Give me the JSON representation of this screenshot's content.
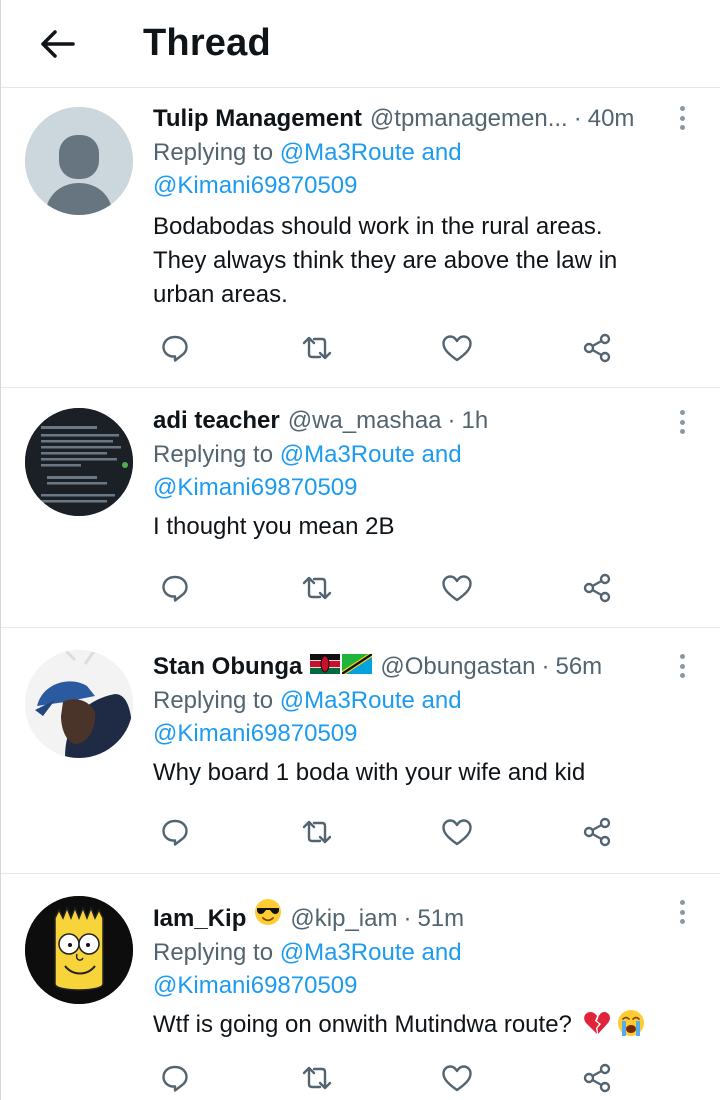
{
  "header": {
    "title": "Thread"
  },
  "tweets": [
    {
      "name": "Tulip Management",
      "handle": "@tpmanagemen...",
      "dot": "·",
      "time": "40m",
      "replying_prefix": "Replying to",
      "mention_1": "@Ma3Route",
      "and": "and",
      "mention_2": "@Kimani69870509",
      "text_lines": [
        "Bodabodas should work in the rural areas.",
        "They always think they are above the law in",
        "urban areas."
      ]
    },
    {
      "name": "adi teacher",
      "handle": "@wa_mashaa",
      "dot": "·",
      "time": "1h",
      "replying_prefix": "Replying to",
      "mention_1": "@Ma3Route",
      "and": "and",
      "mention_2": "@Kimani69870509",
      "text_lines": [
        "I thought you mean 2B"
      ]
    },
    {
      "name": "Stan Obunga",
      "handle": "@Obungastan",
      "dot": "·",
      "time": "56m",
      "replying_prefix": "Replying to",
      "mention_1": "@Ma3Route",
      "and": "and",
      "mention_2": "@Kimani69870509",
      "text_lines": [
        "Why board 1 boda with your wife and kid"
      ],
      "name_emoji": [
        "kenya-flag",
        "tanzania-flag"
      ]
    },
    {
      "name": "Iam_Kip",
      "handle": "@kip_iam",
      "dot": "·",
      "time": "51m",
      "replying_prefix": "Replying to",
      "mention_1": "@Ma3Route",
      "and": "and",
      "mention_2": "@Kimani69870509",
      "text_lines": [
        "Wtf is going on onwith Mutindwa route?"
      ],
      "name_emoji": [
        "sunglasses-emoji"
      ],
      "text_emoji": [
        "broken-heart-emoji",
        "crying-face-emoji"
      ]
    }
  ],
  "icons": {
    "back": "arrow-left-icon",
    "more": "more-vertical-icon",
    "reply": "reply-icon",
    "retweet": "retweet-icon",
    "like": "heart-icon",
    "share": "share-icon"
  },
  "colors": {
    "link": "#1d9bf0",
    "secondary_text": "#536471",
    "primary_text": "#0f1419",
    "divider": "#e4e8eb"
  }
}
